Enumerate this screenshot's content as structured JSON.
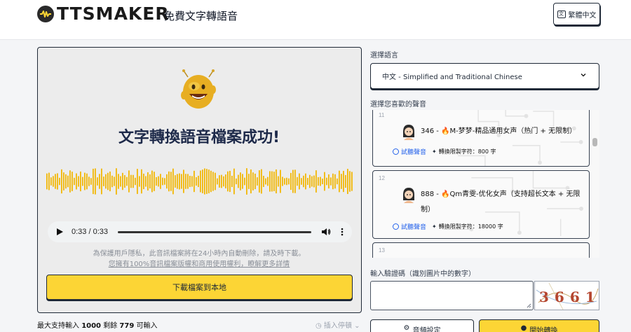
{
  "header": {
    "logo_text": "TTSMAKER",
    "tagline": "免費文字轉語音",
    "language_button": "繁體中文",
    "language_button_icon": "translate-icon"
  },
  "result_panel": {
    "title": "文字轉換語音檔案成功!",
    "player": {
      "time": "0:33 / 0:33",
      "progress": 1.0
    },
    "privacy_line1": "為保護用戶隱私，此音訊檔案將在24小時內自動刪除，請及時下載。",
    "privacy_line2": "您擁有100%音訊檔案版權和商用使用權利，瞭解更多詳情",
    "download_label": "下載檔案到本地"
  },
  "input_footer": {
    "limit_prefix": "最大支持輸入",
    "max": "1000",
    "remaining_label": "剩餘",
    "remaining": "779",
    "limit_suffix": "可輸入",
    "insert_pause": "插入停頓"
  },
  "language": {
    "label": "選擇語言",
    "selected": "中文 - Simplified and Traditional Chinese"
  },
  "voices": {
    "label": "選擇您喜歡的聲音",
    "items": [
      {
        "index": "11",
        "id": "346",
        "name": "M-梦梦-精品通用女声（热门 + 无限制）",
        "preview": "試聽聲音",
        "limit": "轉換限製字符：800 字"
      },
      {
        "index": "12",
        "id": "888",
        "name": "Qm青雯-优化女声（支持超长文本 + 无限制）",
        "preview": "試聽聲音",
        "limit": "轉換限製字符：18000 字"
      },
      {
        "index": "13"
      }
    ]
  },
  "captcha": {
    "label": "輸入驗證碼（識別圖片中的數字）",
    "image_text": "3661"
  },
  "actions": {
    "settings": "音頻設定",
    "convert": "開始轉換"
  },
  "colors": {
    "accent_yellow": "#fcd535",
    "link_blue": "#2563eb",
    "title_navy": "#1e2a4a"
  }
}
